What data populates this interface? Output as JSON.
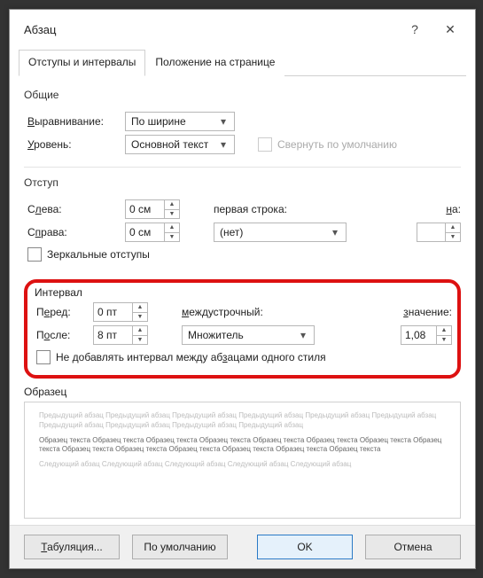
{
  "window": {
    "title": "Абзац"
  },
  "tabs": {
    "t1": "Отступы и интервалы",
    "t2": "Положение на странице"
  },
  "general": {
    "title": "Общие",
    "alignment_label": "Выравнивание:",
    "alignment_value": "По ширине",
    "level_label": "Уровень:",
    "level_value": "Основной текст",
    "collapse_label": "Свернуть по умолчанию"
  },
  "indent": {
    "title": "Отступ",
    "left_label": "Слева:",
    "left_value": "0 см",
    "right_label": "Справа:",
    "right_value": "0 см",
    "first_line_label": "первая строка:",
    "first_line_value": "(нет)",
    "by_label": "на:",
    "by_value": "",
    "mirror_label": "Зеркальные отступы"
  },
  "interval": {
    "title": "Интервал",
    "before_label": "Перед:",
    "before_value": "0 пт",
    "after_label": "После:",
    "after_value": "8 пт",
    "line_label": "междустрочный:",
    "line_value": "Множитель",
    "at_label": "значение:",
    "at_value": "1,08",
    "nospace_label": "Не добавлять интервал между абзацами одного стиля"
  },
  "sample": {
    "title": "Образец",
    "prev": "Предыдущий абзац Предыдущий абзац Предыдущий абзац Предыдущий абзац Предыдущий абзац Предыдущий абзац Предыдущий абзац Предыдущий абзац Предыдущий абзац Предыдущий абзац",
    "cur": "Образец текста Образец текста Образец текста Образец текста Образец текста Образец текста Образец текста Образец текста Образец текста Образец текста Образец текста Образец текста Образец текста Образец текста",
    "next": "Следующий абзац Следующий абзац Следующий абзац Следующий абзац Следующий абзац"
  },
  "footer": {
    "tabs": "Табуляция...",
    "default": "По умолчанию",
    "ok": "OK",
    "cancel": "Отмена"
  }
}
